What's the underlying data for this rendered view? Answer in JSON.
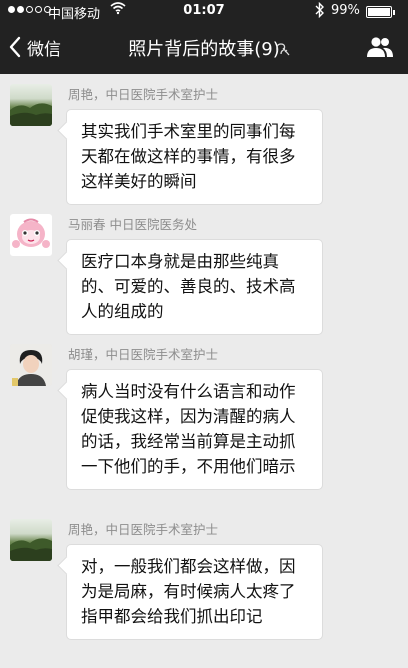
{
  "status_bar": {
    "carrier": "中国移动",
    "time": "01:07",
    "battery_percent": "99%",
    "battery_level": 0.99,
    "signal_bars_filled": 2,
    "signal_bars_total": 5
  },
  "nav": {
    "back_label": "微信",
    "title": "照片背后的故事(9)"
  },
  "messages": [
    {
      "sender": "周艳，中日医院手术室护士",
      "text": "其实我们手术室里的同事们每天都在做这样的事情，有很多这样美好的瞬间",
      "avatar": "landscape-avatar"
    },
    {
      "sender": "马丽春  中日医院医务处",
      "text": "医疗口本身就是由那些纯真的、可爱的、善良的、技术高人的组成的",
      "avatar": "cartoon-avatar"
    },
    {
      "sender": "胡瑾，中日医院手术室护士",
      "text": "病人当时没有什么语言和动作促使我这样，因为清醒的病人的话，我经常当前算是主动抓一下他们的手，不用他们暗示",
      "avatar": "person-photo-avatar"
    },
    {
      "sender": "周艳，中日医院手术室护士",
      "text": "对，一般我们都会这样做，因为是局麻，有时候病人太疼了指甲都会给我们抓出印记",
      "avatar": "landscape-avatar"
    }
  ],
  "colors": {
    "header_bg": "#222222",
    "chat_bg": "#ebebeb",
    "bubble_bg": "#ffffff",
    "sender_text": "#8d8d8d"
  },
  "icons": [
    "chevron-left-icon",
    "wifi-icon",
    "bluetooth-icon",
    "battery-icon",
    "ear-mute-icon",
    "group-members-icon"
  ]
}
